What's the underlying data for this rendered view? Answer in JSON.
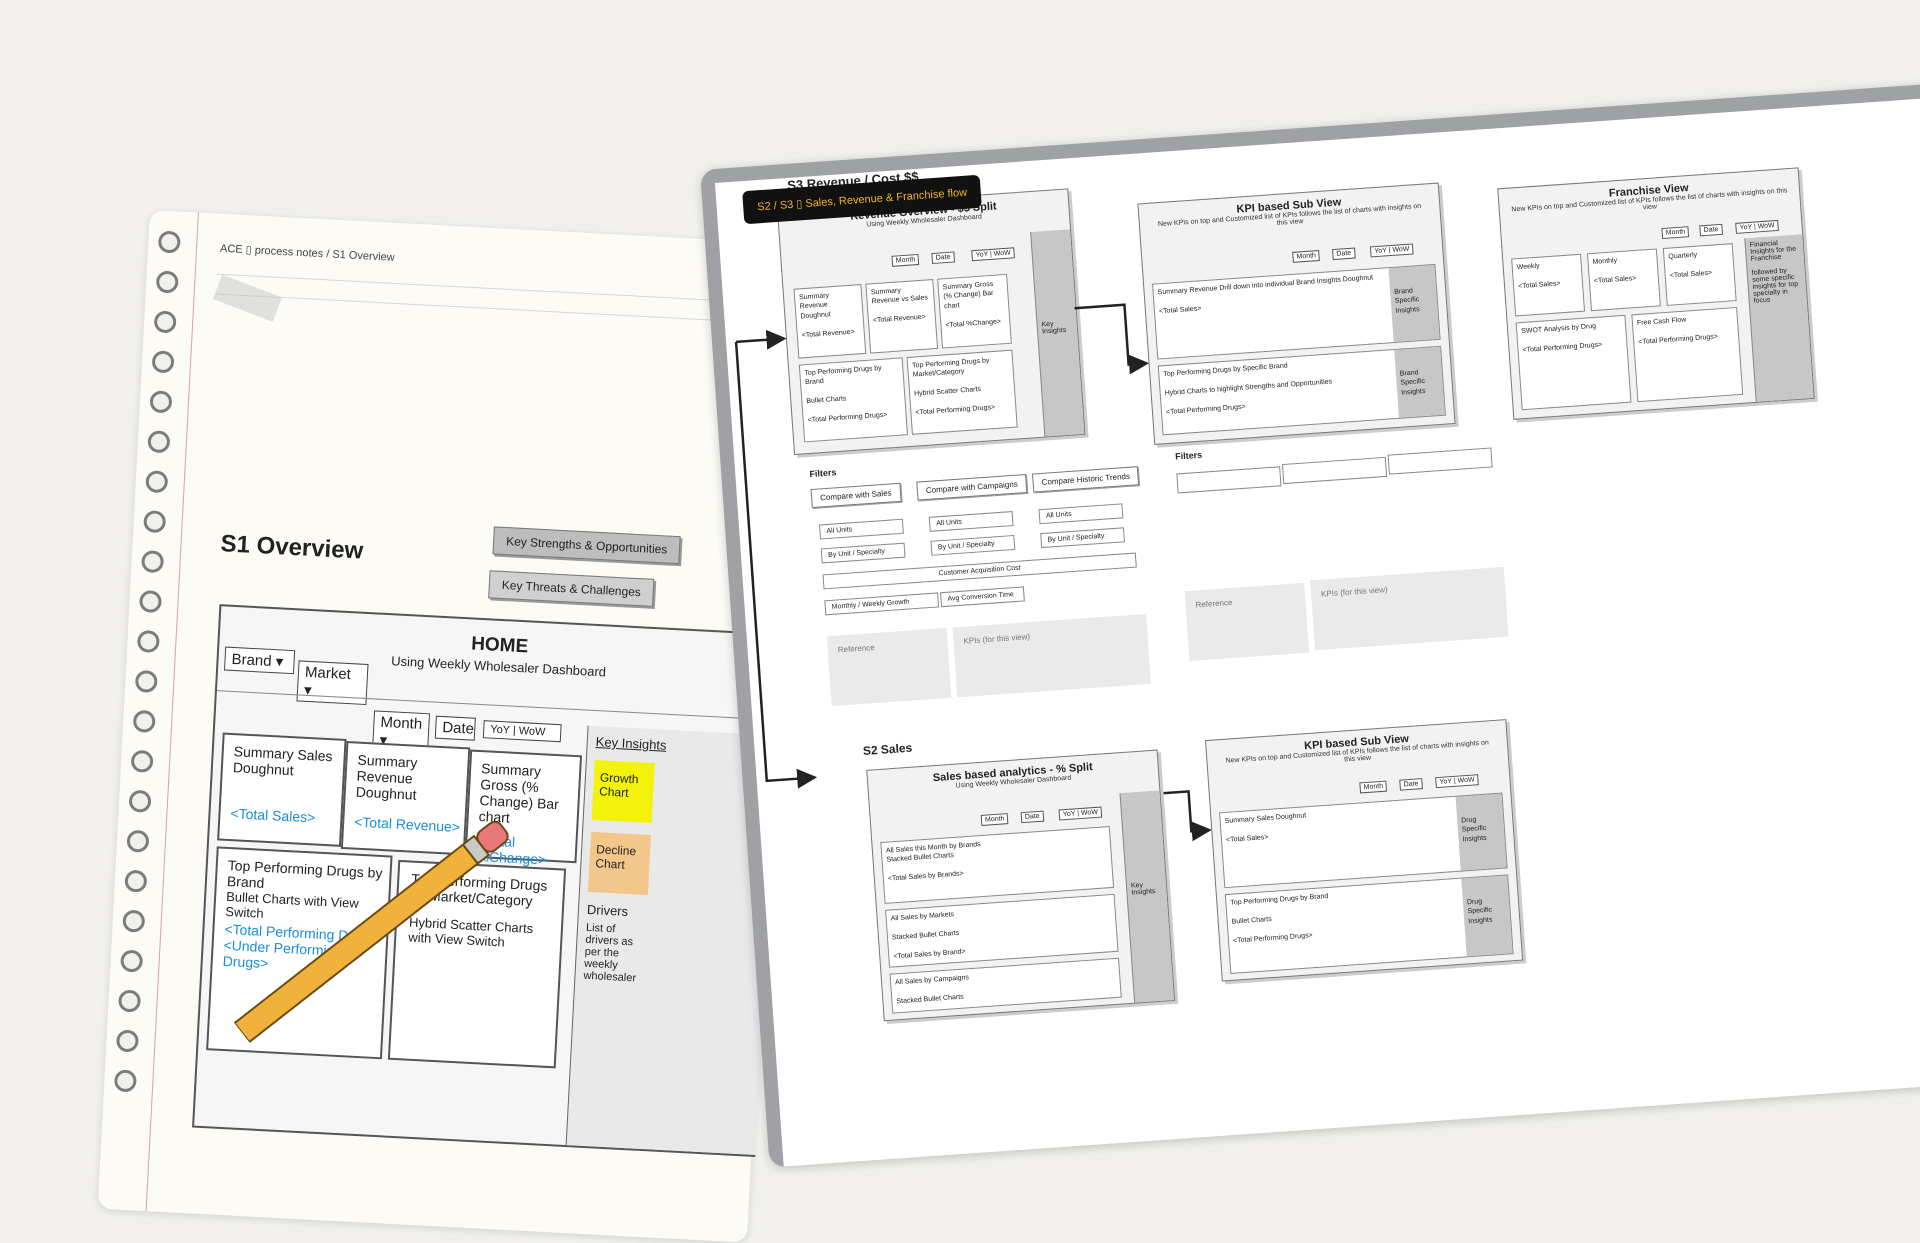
{
  "notebook": {
    "breadcrumb": "ACE ▯ process notes / S1 Overview",
    "page_title": "S1 Overview",
    "strengths_btn": "Key Strengths & Opportunities",
    "threats_btn": "Key Threats & Challenges",
    "home": {
      "title": "HOME",
      "subtitle": "Using Weekly Wholesaler Dashboard",
      "brand_select": "Brand",
      "market_select": "Market",
      "month_select": "Month",
      "date_select": "Date",
      "yoy_wow": "YoY  |  WoW",
      "tiles": [
        {
          "label": "Summary Sales Doughnut",
          "value": "<Total Sales>"
        },
        {
          "label": "Summary Revenue Doughnut",
          "value": "<Total Revenue>"
        },
        {
          "label": "Summary Gross (% Change) Bar chart",
          "value": "<Total %Change>"
        }
      ],
      "bottom_left": {
        "title": "Top Performing Drugs by Brand",
        "line2": "Bullet Charts with View Switch",
        "value": "<Total Performing Drugs>",
        "value2": "<Under Performing Drugs>"
      },
      "bottom_right": {
        "title": "Top Performing Drugs by Market/Category",
        "line2": "Hybrid Scatter Charts with View Switch"
      },
      "key_insights": "Key Insights",
      "growth_chart": "Growth Chart",
      "decline_chart": "Decline Chart",
      "drivers_title": "Drivers",
      "drivers_text": "List of drivers as per the weekly wholesaler"
    }
  },
  "tooltip": "S2 / S3 ▯ Sales, Revenue & Franchise flow",
  "screen": {
    "s3_title": "S3 Revenue / Cost $$",
    "s2_title": "S2 Sales",
    "card1": {
      "title": "Revenue Overview - $$ Split",
      "subtitle": "Using Weekly Wholesaler Dashboard",
      "month": "Month",
      "date": "Date",
      "yoy": "YoY  |  WoW",
      "tiles": [
        {
          "label": "Summary Revenue Doughnut",
          "value": "<Total Revenue>"
        },
        {
          "label": "Summary Revenue vs Sales",
          "value": "<Total Revenue>"
        },
        {
          "label": "Summary Gross (% Change) Bar chart",
          "value": "<Total %Change>"
        }
      ],
      "bottom_left": {
        "title": "Top Performing Drugs by Brand",
        "line2": "Bullet Charts",
        "value": "<Total Performing Drugs>"
      },
      "bottom_right": {
        "title": "Top Performing Drugs by Market/Category",
        "line2": "Hybrid Scatter Charts",
        "value": "<Total Performing Drugs>"
      },
      "side": "Key Insights"
    },
    "card2": {
      "title": "KPI based Sub View",
      "subtitle": "New KPIs on top and Customized list of KPIs follows the list of charts with insights on this view",
      "month": "Month",
      "date": "Date",
      "yoy": "YoY  |  WoW",
      "row1": {
        "title": "Summary Revenue Drill down into individual Brand Insights Doughnut",
        "value": "<Total Sales>",
        "side": "Brand Specific Insights"
      },
      "row2": {
        "title": "Top Performing Drugs by Specific Brand",
        "line2": "Hybrid Charts to highlight Strengths and Opportunities",
        "value": "<Total Performing Drugs>",
        "side": "Brand Specific Insights"
      }
    },
    "card3": {
      "title": "Franchise View",
      "subtitle": "New KPIs on top and Customized list of KPIs follows the list of charts with insights on this view",
      "month": "Month",
      "date": "Date",
      "yoy": "YoY  |  WoW",
      "tiles": [
        {
          "label": "Weekly",
          "value": "<Total Sales>"
        },
        {
          "label": "Monthly",
          "value": "<Total Sales>"
        },
        {
          "label": "Quarterly",
          "value": "<Total Sales>"
        }
      ],
      "bottom_left": {
        "title": "SWOT Analysis by Drug",
        "value": "<Total Performing Drugs>"
      },
      "bottom_right": {
        "title": "Free Cash Flow",
        "value": "<Total Performing Drugs>"
      },
      "side": "Financial Insights for the Franchise\n\nfollowed by some specific insights for top specialty in focus"
    },
    "filters": {
      "title": "Filters",
      "buttons": [
        "Compare with Sales",
        "Compare with Campaigns",
        "Compare Historic Trends"
      ],
      "opts_a": [
        "All Units",
        "By Unit / Specialty"
      ],
      "opts_b": [
        "All Units",
        "By Unit / Specialty"
      ],
      "opts_c": [
        "All Units",
        "By Unit / Specialty"
      ],
      "cac": "Customer Acquisition Cost",
      "growth": "Monthly / Weekly Growth",
      "avg": "Avg Conversion Time"
    },
    "filters2_title": "Filters",
    "ref1": {
      "reference": "Reference",
      "kpis": "KPIs (for this view)"
    },
    "ref2": {
      "reference": "Reference",
      "kpis": "KPIs (for this view)"
    },
    "card4": {
      "title": "Sales based analytics - % Split",
      "subtitle": "Using Weekly Wholesaler Dashboard",
      "month": "Month",
      "date": "Date",
      "yoy": "YoY  |  WoW",
      "rows": [
        {
          "title": "All Sales this Month by Brands",
          "line2": "Stacked Bullet Charts",
          "value": "<Total Sales by Brands>"
        },
        {
          "title": "All Sales by Markets",
          "line2": "Stacked Bullet Charts",
          "value": "<Total Sales by Brand>"
        },
        {
          "title": "All Sales by Campaigns",
          "line2": "Stacked Bullet Charts",
          "value": ""
        }
      ],
      "side": "Key Insights"
    },
    "card5": {
      "title": "KPI based Sub View",
      "subtitle": "New KPIs on top and Customized list of KPIs follows the list of charts with insights on this view",
      "month": "Month",
      "date": "Date",
      "yoy": "YoY  |  WoW",
      "row1": {
        "title": "Summary Sales Doughnut",
        "value": "<Total Sales>",
        "side": "Drug Specific Insights"
      },
      "row2": {
        "title": "Top Performing Drugs by Brand",
        "line2": "Bullet Charts",
        "value": "<Total Performing Drugs>",
        "side": "Drug Specific Insights"
      }
    }
  },
  "colors": {
    "background": "#f1f0ec",
    "accent_blue": "#1a8de0",
    "highlight_yellow": "#f2f20a",
    "decline_orange": "#f3c68a",
    "tooltip_text": "#f0b429"
  }
}
